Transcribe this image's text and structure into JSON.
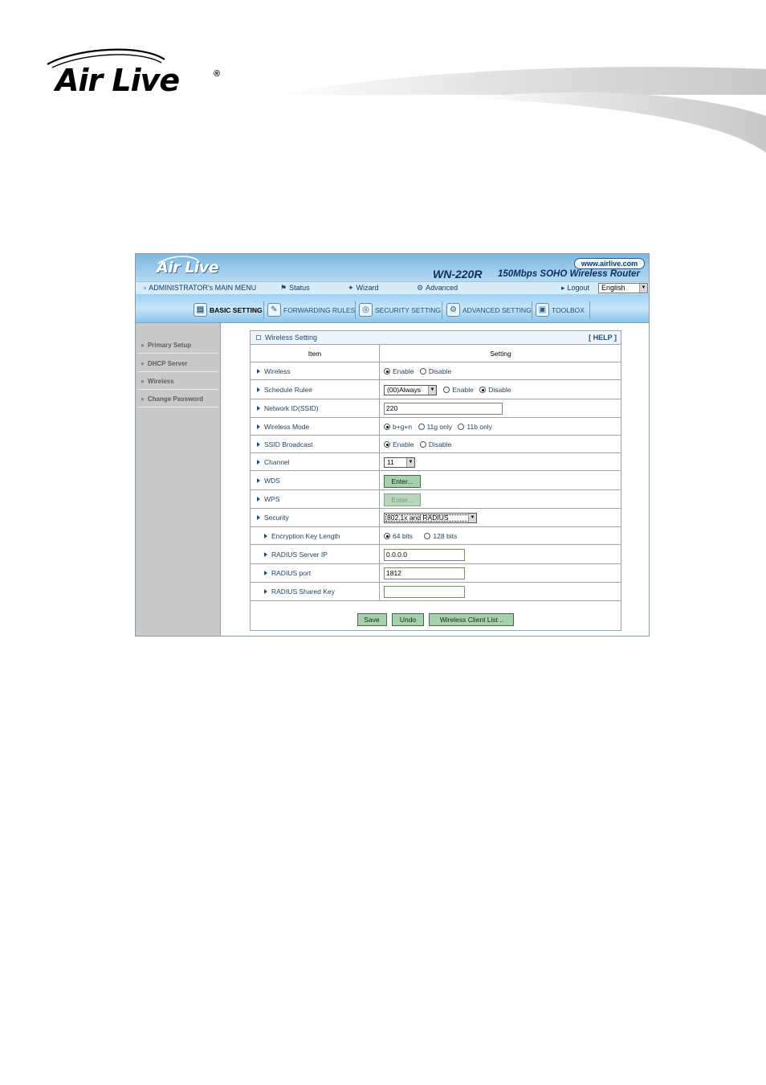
{
  "doc": {
    "logo_text": "Air Live",
    "logo_mark": "®"
  },
  "router": {
    "logo_text": "Air Live",
    "url": "www.airlive.com",
    "model": "WN-220R",
    "tagline": "150Mbps SOHO Wireless Router",
    "menu": {
      "main": "ADMINISTRATOR's MAIN MENU",
      "status": "Status",
      "wizard": "Wizard",
      "advanced": "Advanced",
      "logout": "Logout",
      "language": "English"
    },
    "tabs": [
      {
        "label": "BASIC SETTING",
        "icon": "book-icon"
      },
      {
        "label": "FORWARDING RULES",
        "icon": "wrench-icon"
      },
      {
        "label": "SECURITY SETTING",
        "icon": "lock-icon"
      },
      {
        "label": "ADVANCED SETTING",
        "icon": "gear-icon"
      },
      {
        "label": "TOOLBOX",
        "icon": "toolbox-icon"
      }
    ],
    "sidebar": [
      {
        "label": "Primary Setup"
      },
      {
        "label": "DHCP Server"
      },
      {
        "label": "Wireless"
      },
      {
        "label": "Change Password"
      }
    ],
    "panel": {
      "title": "Wireless Setting",
      "help": "[ HELP ]",
      "col_item": "Item",
      "col_setting": "Setting",
      "rows": {
        "wireless": {
          "label": "Wireless",
          "opt1": "Enable",
          "opt2": "Disable"
        },
        "schedule": {
          "label": "Schedule Rule#",
          "select": "(00)Always",
          "opt1": "Enable",
          "opt2": "Disable"
        },
        "ssid": {
          "label": "Network ID(SSID)",
          "value": "220"
        },
        "mode": {
          "label": "Wireless Mode",
          "opt1": "b+g+n",
          "opt2": "11g only",
          "opt3": "11b only"
        },
        "broadcast": {
          "label": "SSID Broadcast",
          "opt1": "Enable",
          "opt2": "Disable"
        },
        "channel": {
          "label": "Channel",
          "select": "11"
        },
        "wds": {
          "label": "WDS",
          "button": "Enter..."
        },
        "wps": {
          "label": "WPS",
          "button": "Enter..."
        },
        "security": {
          "label": "Security",
          "select": "802.1x and RADIUS"
        },
        "keylen": {
          "label": "Encryption Key Length",
          "opt1": "64 bits",
          "opt2": "128 bits"
        },
        "radius_ip": {
          "label": "RADIUS Server IP",
          "value": "0.0.0.0"
        },
        "radius_port": {
          "label": "RADIUS port",
          "value": "1812"
        },
        "radius_key": {
          "label": "RADIUS Shared Key",
          "value": ""
        }
      },
      "buttons": {
        "save": "Save",
        "undo": "Undo",
        "client_list": "Wireless Client List .."
      }
    }
  }
}
